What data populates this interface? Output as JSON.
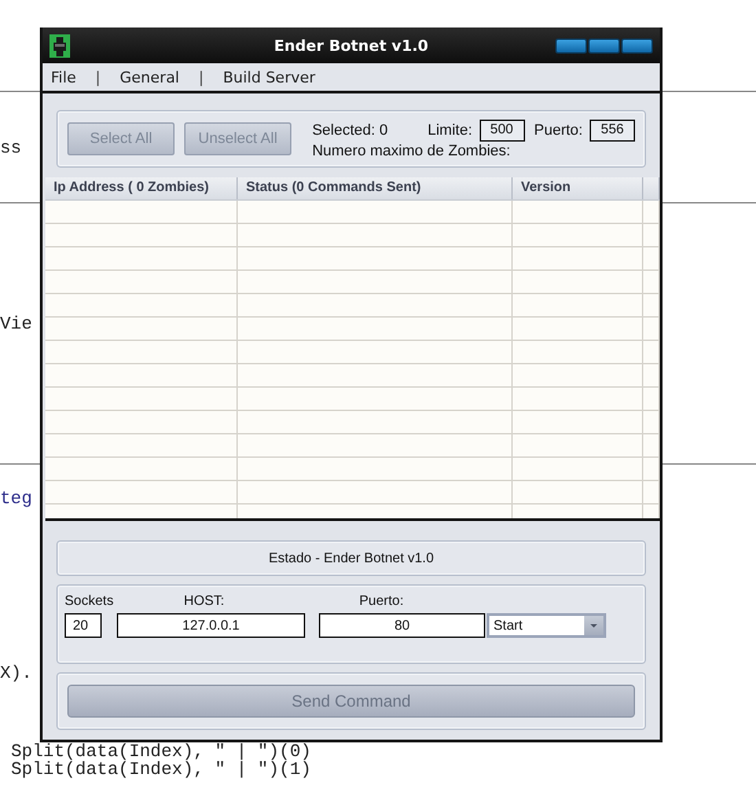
{
  "background_code": [
    {
      "text": "ss"
    },
    {
      "text": "Vie"
    },
    {
      "text": "teg"
    },
    {
      "text": "X)."
    },
    {
      "text": "Split(data(Index), \" | \")(0)"
    },
    {
      "text": "Split(data(Index), \" | \")(1)"
    }
  ],
  "window": {
    "title": "Ender Botnet v1.0"
  },
  "menu": [
    {
      "kind": "item",
      "label": "File"
    },
    {
      "kind": "separator",
      "label": "|"
    },
    {
      "kind": "item",
      "label": "General"
    },
    {
      "kind": "separator",
      "label": "|"
    },
    {
      "kind": "item",
      "label": "Build Server"
    }
  ],
  "selection": {
    "buttons": [
      "Select All",
      "Unselect All"
    ],
    "selected_label": "Selected: 0",
    "limit_label": "Limite:",
    "limit_value": "500",
    "port_label": "Puerto:",
    "port_value": "556",
    "max_label": "Numero maximo de Zombies:"
  },
  "table": {
    "columns": [
      "Ip Address ( 0 Zombies)",
      "Status (0 Commands Sent)",
      "Version"
    ]
  },
  "status": "Estado - Ender Botnet v1.0",
  "connection": {
    "sockets_label": "Sockets",
    "sockets": "20",
    "host_label": "HOST:",
    "host": "127.0.0.1",
    "port_label": "Puerto:",
    "port": "80",
    "action": "Start"
  },
  "send_button": "Send Command"
}
